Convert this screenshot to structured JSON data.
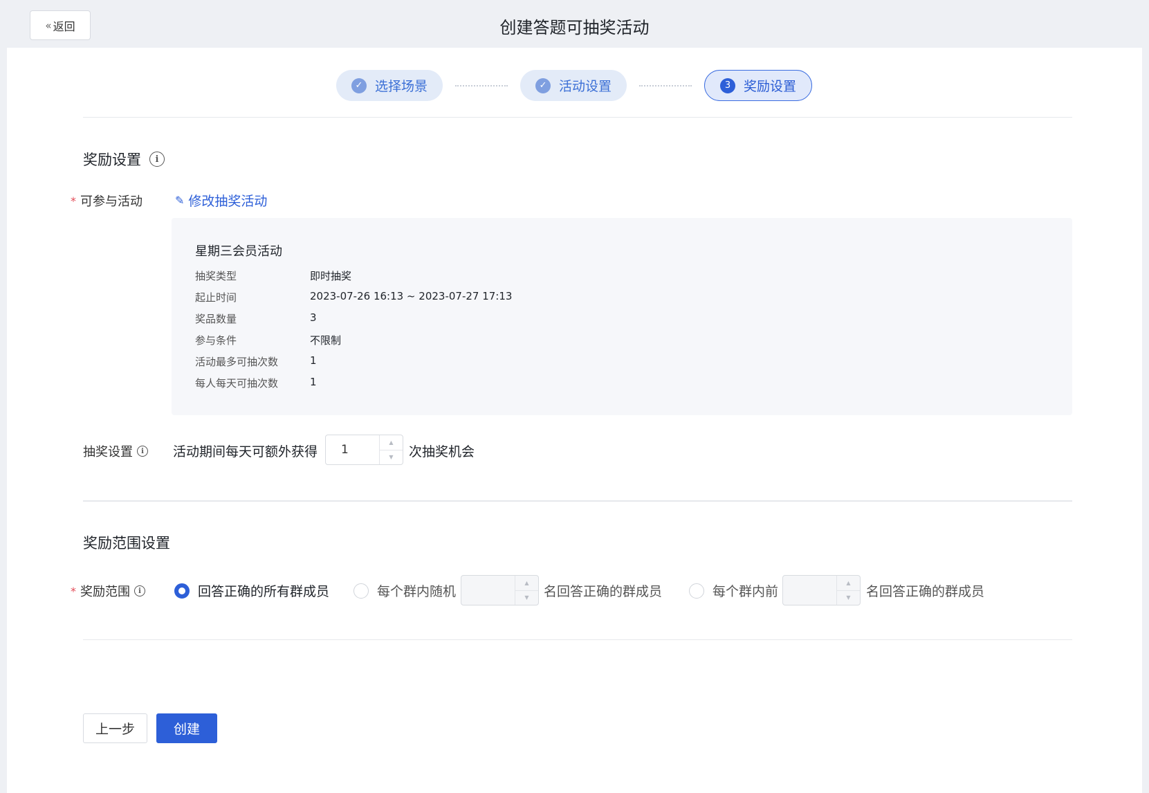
{
  "header": {
    "back_label": "返回",
    "title": "创建答题可抽奖活动"
  },
  "steps": [
    {
      "label": "选择场景",
      "icon": "check-icon"
    },
    {
      "label": "活动设置",
      "icon": "check-icon"
    },
    {
      "label": "奖励设置",
      "number": "3"
    }
  ],
  "reward_section": {
    "title": "奖励设置",
    "participate_label": "可参与活动",
    "edit_link": "修改抽奖活动",
    "activity": {
      "name": "星期三会员活动",
      "rows": [
        {
          "key": "抽奖类型",
          "value": "即时抽奖"
        },
        {
          "key": "起止时间",
          "value": "2023-07-26 16:13 ~ 2023-07-27 17:13"
        },
        {
          "key": "奖品数量",
          "value": "3"
        },
        {
          "key": "参与条件",
          "value": "不限制"
        },
        {
          "key": "活动最多可抽次数",
          "value": "1"
        },
        {
          "key": "每人每天可抽次数",
          "value": "1"
        }
      ]
    },
    "lottery_label": "抽奖设置",
    "lottery_prefix": "活动期间每天可额外获得",
    "lottery_value": "1",
    "lottery_suffix": "次抽奖机会"
  },
  "range_section": {
    "title": "奖励范围设置",
    "label": "奖励范围",
    "option_all": "回答正确的所有群成员",
    "option_random": "每个群内随机",
    "option_random_suffix": "名回答正确的群成员",
    "option_top": "每个群内前",
    "option_top_suffix": "名回答正确的群成员",
    "selected": "all"
  },
  "footer": {
    "prev_label": "上一步",
    "create_label": "创建"
  },
  "colors": {
    "primary": "#2d5fd8",
    "required": "#e34d59",
    "page_bg": "#eef0f4"
  }
}
